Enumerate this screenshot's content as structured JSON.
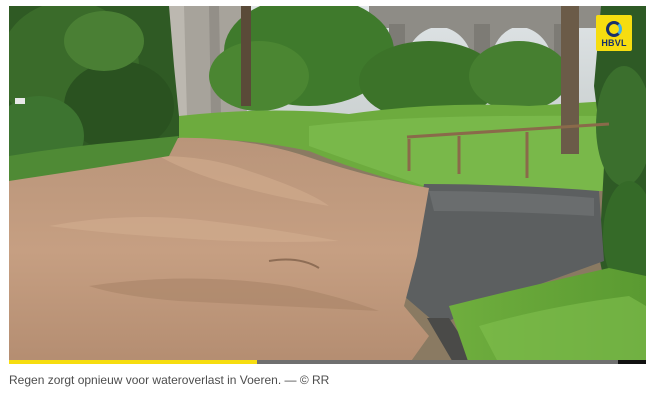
{
  "media": {
    "logo_text": "HBVL",
    "accent_color": "#f6dd10",
    "logo_icon": "hbvl-ring-logo",
    "progress_fraction": 0.39
  },
  "caption": {
    "text": "Regen zorgt opnieuw voor wateroverlast in Voeren. — © RR"
  }
}
